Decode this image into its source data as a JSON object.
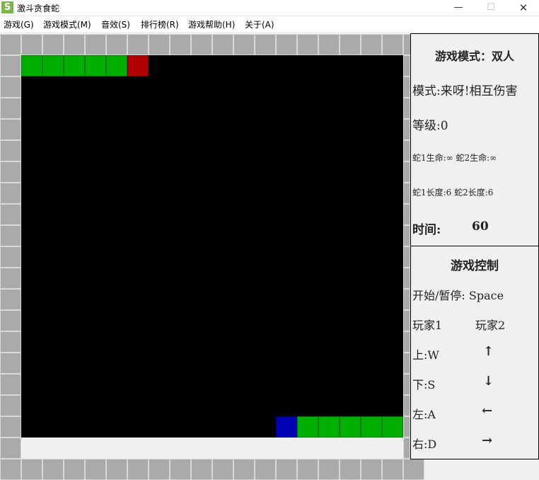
{
  "window": {
    "icon_letter": "S",
    "title": "激斗贪食蛇",
    "minimize": "—",
    "maximize": "☐",
    "close": "✕"
  },
  "menu": [
    "游戏(G)",
    "游戏模式(M)",
    "音效(S)",
    "排行榜(R)",
    "游戏帮助(H)",
    "关于(A)"
  ],
  "info": {
    "mode_title": "游戏模式：双人",
    "mode": "模式:来呀!相互伤害",
    "level": "等级:0",
    "lives": "蛇1生命:∞ 蛇2生命:∞",
    "lengths": "蛇1长度:6 蛇2长度:6",
    "time_label": "时间:",
    "time_value": "60"
  },
  "controls": {
    "title": "游戏控制",
    "start_pause": "开始/暂停: Space",
    "player1": "玩家1",
    "player2": "玩家2",
    "up1": "上:W",
    "up2": "↑",
    "down1": "下:S",
    "down2": "↓",
    "left1": "左:A",
    "left2": "←",
    "right1": "右:D",
    "right2": "→"
  },
  "game": {
    "grid_cols": 19,
    "grid_rows": 20,
    "snake1": {
      "color": "#00b000",
      "head_color": "#b00000",
      "head": [
        6,
        1
      ],
      "body": [
        [
          5,
          1
        ],
        [
          4,
          1
        ],
        [
          3,
          1
        ],
        [
          2,
          1
        ],
        [
          1,
          1
        ]
      ]
    },
    "snake2": {
      "color": "#00b000",
      "head_color": "#0000b4",
      "head": [
        13,
        18
      ],
      "body": [
        [
          14,
          18
        ],
        [
          15,
          18
        ],
        [
          16,
          18
        ],
        [
          17,
          18
        ],
        [
          18,
          18
        ]
      ]
    },
    "wall_color": "#aaaaaa",
    "arena_color": "#000000"
  }
}
